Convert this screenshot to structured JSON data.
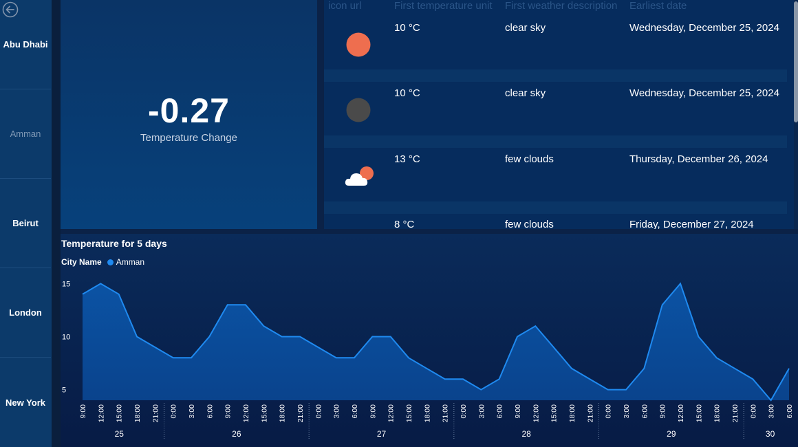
{
  "sidebar": {
    "back_icon": "arrow-left-circle-icon",
    "cities": [
      {
        "label": "Abu Dhabi",
        "active": false
      },
      {
        "label": "Amman",
        "active": true
      },
      {
        "label": "Beirut",
        "active": false
      },
      {
        "label": "London",
        "active": false
      },
      {
        "label": "New York",
        "active": false
      }
    ]
  },
  "kpi": {
    "value": "-0.27",
    "label": "Temperature Change"
  },
  "table": {
    "headers": [
      "icon url",
      "First temperature unit",
      "First weather description",
      "Earliest date"
    ],
    "rows": [
      {
        "icon": "sun-icon",
        "icon_color": "#ee6e4f",
        "temp": "10 °C",
        "desc": "clear sky",
        "date": "Wednesday, December 25, 2024"
      },
      {
        "icon": "moon-icon",
        "icon_color": "#4a4a4a",
        "temp": "10 °C",
        "desc": "clear sky",
        "date": "Wednesday, December 25, 2024"
      },
      {
        "icon": "cloud-sun-icon",
        "icon_color": "#ee6e4f",
        "temp": "13 °C",
        "desc": "few clouds",
        "date": "Thursday, December 26, 2024"
      },
      {
        "icon": "none",
        "icon_color": "",
        "temp": "8 °C",
        "desc": "few clouds",
        "date": "Friday, December 27, 2024"
      }
    ]
  },
  "chart": {
    "title": "Temperature for 5 days",
    "legend_title": "City Name",
    "legend_item": "Amman",
    "series_color": "#1f8af0"
  },
  "chart_data": {
    "type": "area",
    "title": "Temperature for 5 days",
    "xlabel": "",
    "ylabel": "",
    "ylim": [
      4,
      16
    ],
    "yticks": [
      5,
      10,
      15
    ],
    "grid": false,
    "legend_placement": "top-left",
    "series": [
      {
        "name": "Amman",
        "x": [
          "9:00",
          "12:00",
          "15:00",
          "18:00",
          "21:00",
          "0:00",
          "3:00",
          "6:00",
          "9:00",
          "12:00",
          "15:00",
          "18:00",
          "21:00",
          "0:00",
          "3:00",
          "6:00",
          "9:00",
          "12:00",
          "15:00",
          "18:00",
          "21:00",
          "0:00",
          "3:00",
          "6:00",
          "9:00",
          "12:00",
          "15:00",
          "18:00",
          "21:00",
          "0:00",
          "3:00",
          "6:00",
          "9:00",
          "12:00",
          "15:00",
          "18:00",
          "21:00",
          "0:00",
          "3:00",
          "6:00"
        ],
        "values": [
          14,
          15,
          14,
          10,
          9,
          8,
          8,
          10,
          13,
          13,
          11,
          10,
          10,
          9,
          8,
          8,
          10,
          10,
          8,
          7,
          6,
          6,
          5,
          6,
          10,
          11,
          9,
          7,
          6,
          5,
          5,
          7,
          13,
          15,
          10,
          8,
          7,
          6,
          4,
          7
        ]
      }
    ],
    "day_groups": [
      {
        "label": "25",
        "count": 5
      },
      {
        "label": "26",
        "count": 8
      },
      {
        "label": "27",
        "count": 8
      },
      {
        "label": "28",
        "count": 8
      },
      {
        "label": "29",
        "count": 8
      },
      {
        "label": "30",
        "count": 3
      }
    ]
  }
}
